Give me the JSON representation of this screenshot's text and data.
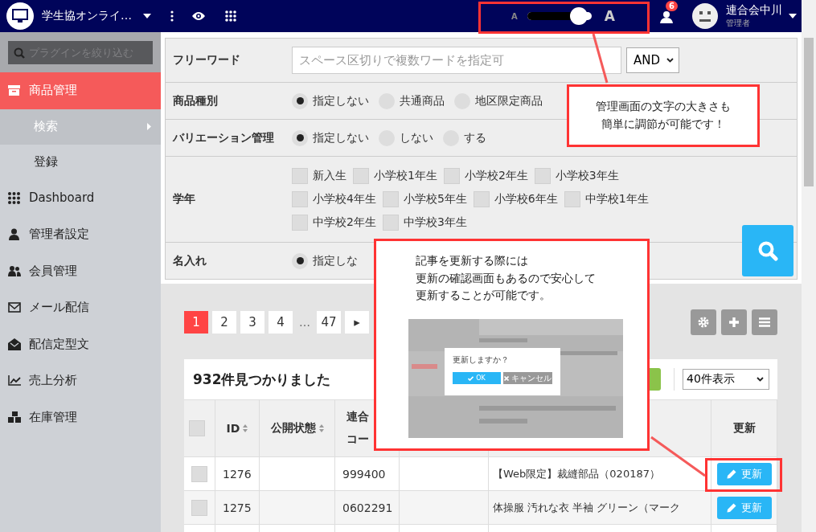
{
  "header": {
    "site_title": "学生協オンライ…",
    "font_size": {
      "small_label": "A",
      "large_label": "A",
      "level": 0.8
    },
    "notification_count": "6",
    "user": {
      "name": "連合会中川",
      "role": "管理者"
    }
  },
  "sidebar": {
    "search_placeholder": "プラグインを絞り込む",
    "items": [
      {
        "label": "商品管理",
        "selected": true,
        "children": [
          {
            "label": "検索",
            "selected": true
          },
          {
            "label": "登録",
            "selected": false
          }
        ]
      },
      {
        "label": "Dashboard",
        "selected": false
      },
      {
        "label": "管理者設定",
        "selected": false
      },
      {
        "label": "会員管理",
        "selected": false
      },
      {
        "label": "メール配信",
        "selected": false
      },
      {
        "label": "配信定型文",
        "selected": false
      },
      {
        "label": "売上分析",
        "selected": false
      },
      {
        "label": "在庫管理",
        "selected": false
      }
    ]
  },
  "search_form": {
    "rows": [
      {
        "kind": "text",
        "label": "フリーワード",
        "placeholder": "スペース区切りで複数ワードを指定可",
        "operator": "AND"
      },
      {
        "kind": "radio",
        "label": "商品種別",
        "options": [
          {
            "label": "指定しない",
            "selected": true
          },
          {
            "label": "共通商品",
            "selected": false
          },
          {
            "label": "地区限定商品",
            "selected": false
          }
        ]
      },
      {
        "kind": "radio",
        "label": "バリエーション管理",
        "options": [
          {
            "label": "指定しない",
            "selected": true
          },
          {
            "label": "しない",
            "selected": false
          },
          {
            "label": "する",
            "selected": false
          }
        ]
      },
      {
        "kind": "checkbox",
        "label": "学年",
        "options": [
          {
            "label": "新入生",
            "checked": false
          },
          {
            "label": "小学校1年生",
            "checked": false
          },
          {
            "label": "小学校2年生",
            "checked": false
          },
          {
            "label": "小学校3年生",
            "checked": false
          },
          {
            "label": "小学校4年生",
            "checked": false
          },
          {
            "label": "小学校5年生",
            "checked": false
          },
          {
            "label": "小学校6年生",
            "checked": false
          },
          {
            "label": "中学校1年生",
            "checked": false
          },
          {
            "label": "中学校2年生",
            "checked": false
          },
          {
            "label": "中学校3年生",
            "checked": false
          }
        ]
      },
      {
        "kind": "radio",
        "label": "名入れ",
        "options": [
          {
            "label": "指定しな",
            "selected": true
          }
        ]
      }
    ]
  },
  "pagination": {
    "pages": [
      {
        "label": "1",
        "selected": true
      },
      {
        "label": "2",
        "selected": false
      },
      {
        "label": "3",
        "selected": false
      },
      {
        "label": "4",
        "selected": false
      },
      {
        "label": "…",
        "kind": "gap"
      },
      {
        "label": "47",
        "selected": false
      }
    ],
    "next": "▸"
  },
  "results": {
    "title": "932件見つかりました",
    "per_page": "40件表示",
    "columns": [
      {
        "kind": "check",
        "checked": false
      },
      {
        "label": "ID",
        "sortable": true
      },
      {
        "label": "公開状態",
        "sortable": true
      },
      {
        "label_lines": [
          "連合",
          "コー"
        ]
      },
      {
        "kind": "hidden"
      },
      {
        "kind": "hidden"
      },
      {
        "label": "更新"
      }
    ],
    "rows": [
      {
        "checked": false,
        "id": "1276",
        "code": "999400",
        "name": "【Web限定】裁縫部品（020187）",
        "button": "更新"
      },
      {
        "checked": false,
        "id": "1275",
        "code": "0602291",
        "name": "体操服 汚れな衣 半袖 グリーン（マーク",
        "button": "更新"
      }
    ]
  },
  "callouts": [
    {
      "lines": [
        "管理画面の文字の大きさも",
        "簡単に調節が可能です！"
      ]
    },
    {
      "lines": [
        "記事を更新する際には",
        "更新の確認画面もあるので安心して",
        "更新することが可能です。"
      ],
      "screenshot": {
        "question": "更新しますか？",
        "ok": "OK",
        "cancel": "キャンセル"
      }
    }
  ]
}
